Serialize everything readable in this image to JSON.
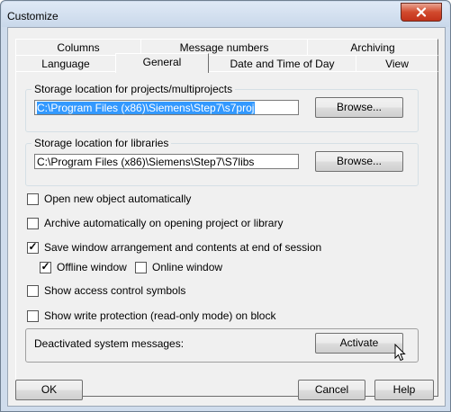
{
  "window": {
    "title": "Customize",
    "close_icon": "close-icon"
  },
  "tabs": {
    "row_top": [
      {
        "id": "columns",
        "label": "Columns"
      },
      {
        "id": "message-numbers",
        "label": "Message numbers"
      },
      {
        "id": "archiving",
        "label": "Archiving"
      }
    ],
    "row_bottom": [
      {
        "id": "language",
        "label": "Language"
      },
      {
        "id": "general",
        "label": "General"
      },
      {
        "id": "date-time",
        "label": "Date and Time of Day"
      },
      {
        "id": "view",
        "label": "View"
      }
    ],
    "active": "General"
  },
  "projects_group": {
    "label": "Storage location for projects/multiprojects",
    "path": "C:\\Program Files (x86)\\Siemens\\Step7\\s7proj",
    "browse_label": "Browse..."
  },
  "libraries_group": {
    "label": "Storage location for libraries",
    "path": "C:\\Program Files (x86)\\Siemens\\Step7\\S7libs",
    "browse_label": "Browse..."
  },
  "options": [
    {
      "id": "open-new",
      "label": "Open new object automatically",
      "checked": false
    },
    {
      "id": "archive-auto",
      "label": "Archive automatically on opening project or library",
      "checked": false
    },
    {
      "id": "save-window",
      "label": "Save window arrangement and contents at end of session",
      "checked": true
    },
    {
      "id": "offline-window",
      "label": "Offline window",
      "checked": true
    },
    {
      "id": "online-window",
      "label": "Online window",
      "checked": false
    },
    {
      "id": "access-control",
      "label": "Show access control symbols",
      "checked": false
    },
    {
      "id": "write-protection",
      "label": "Show write protection (read-only mode) on block",
      "checked": false
    }
  ],
  "system_messages": {
    "label": "Deactivated system messages:",
    "button_label": "Activate"
  },
  "footer": {
    "ok_label": "OK",
    "cancel_label": "Cancel",
    "help_label": "Help"
  },
  "colors": {
    "close_button": "#c9452a",
    "selection": "#3399ff"
  }
}
